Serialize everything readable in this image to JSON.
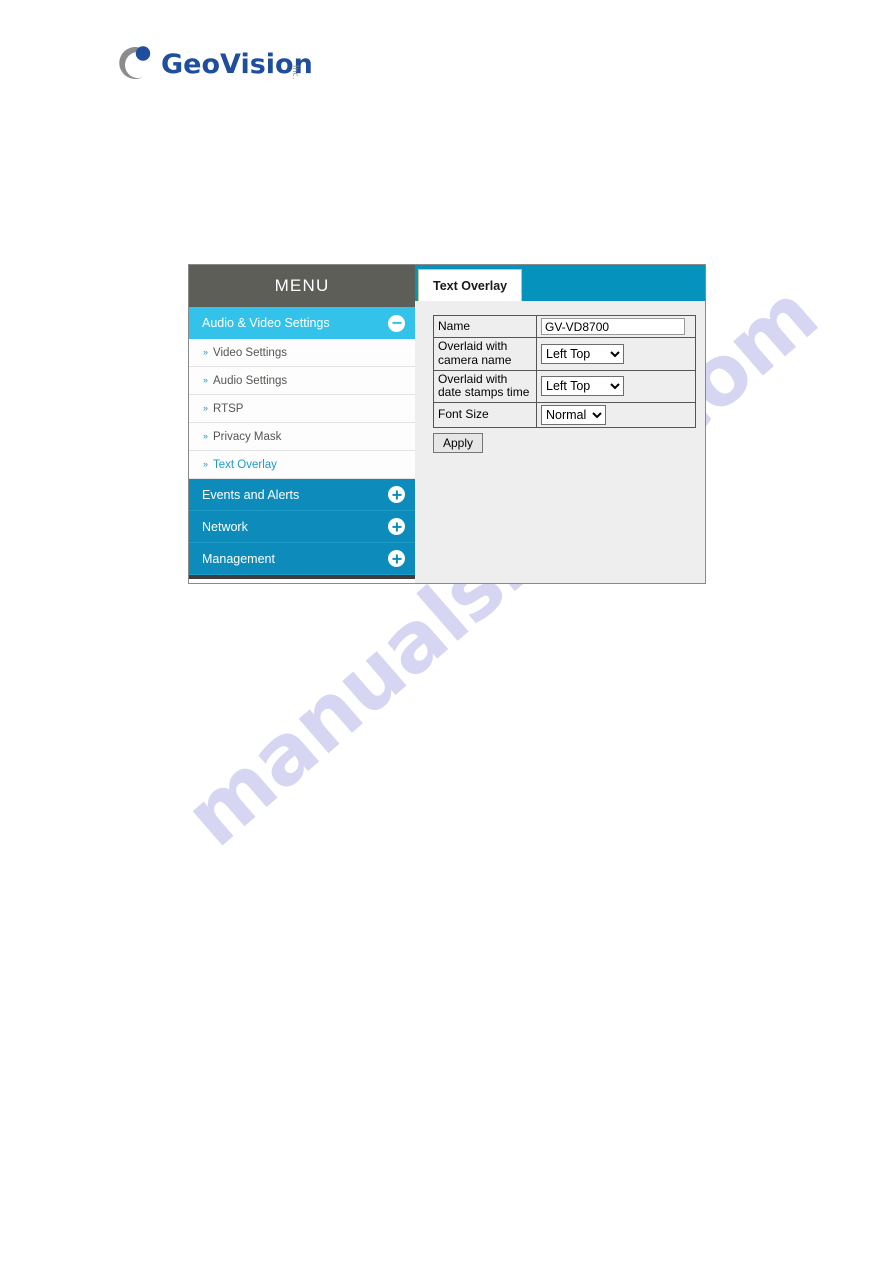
{
  "brand": {
    "name": "GeoVision",
    "suffix": "Inc."
  },
  "watermark": {
    "text": "manualshive.com"
  },
  "menu": {
    "header": "MENU",
    "groups": [
      {
        "label": "Audio & Video Settings",
        "state": "open",
        "icon": "minus-circle-icon",
        "items": [
          {
            "label": "Video Settings",
            "active": false
          },
          {
            "label": "Audio Settings",
            "active": false
          },
          {
            "label": "RTSP",
            "active": false
          },
          {
            "label": "Privacy Mask",
            "active": false
          },
          {
            "label": "Text Overlay",
            "active": true
          }
        ]
      },
      {
        "label": "Events and Alerts",
        "state": "collapsed",
        "icon": "plus-circle-icon",
        "items": []
      },
      {
        "label": "Network",
        "state": "collapsed",
        "icon": "plus-circle-icon",
        "items": []
      },
      {
        "label": "Management",
        "state": "collapsed",
        "icon": "plus-circle-icon",
        "items": []
      }
    ]
  },
  "content": {
    "tab": "Text Overlay",
    "form": {
      "rows": [
        {
          "label": "Name",
          "control": "text",
          "value": "GV-VD8700"
        },
        {
          "label": "Overlaid with camera name",
          "control": "select",
          "value": "Left Top"
        },
        {
          "label": "Overlaid with date stamps time",
          "control": "select",
          "value": "Left Top"
        },
        {
          "label": "Font Size",
          "control": "select",
          "value": "Normal"
        }
      ],
      "apply_label": "Apply"
    }
  },
  "colors": {
    "menu_header_gray": "#5e5e59",
    "group_open_cyan": "#33c3ea",
    "group_collapsed_blue": "#0d8cbb",
    "tabbar_blue": "#0593bd",
    "active_item_teal": "#1b9bc6",
    "brand_blue": "#1f4e9c"
  }
}
